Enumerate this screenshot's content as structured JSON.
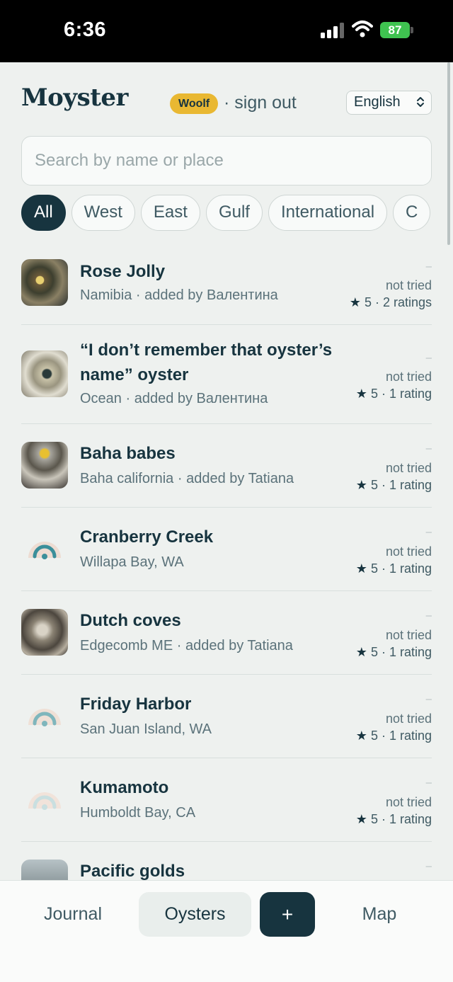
{
  "statusbar": {
    "time": "6:36",
    "battery": "87"
  },
  "header": {
    "logo": "Moyster",
    "user": "Woolf",
    "signout": "· sign out",
    "language": "English"
  },
  "search": {
    "placeholder": "Search by name or place"
  },
  "filters": [
    "All",
    "West",
    "East",
    "Gulf",
    "International",
    "C"
  ],
  "oysters": [
    {
      "name": "Rose Jolly",
      "sub": "Namibia · added by Валентина",
      "dash": "–",
      "status": "not tried",
      "rating": "5 · 2 ratings"
    },
    {
      "name": "“I don’t remember that oyster’s",
      "name2": "name” oyster",
      "sub": "Ocean · added by Валентина",
      "dash": "–",
      "status": "not tried",
      "rating": "5 · 1 rating"
    },
    {
      "name": "Baha babes",
      "sub": "Baha california · added by Tatiana",
      "dash": "–",
      "status": "not tried",
      "rating": "5 · 1 rating"
    },
    {
      "name": "Cranberry Creek",
      "sub": "Willapa Bay, WA",
      "dash": "–",
      "status": "not tried",
      "rating": "5 · 1 rating"
    },
    {
      "name": "Dutch coves",
      "sub": "Edgecomb ME · added by Tatiana",
      "dash": "–",
      "status": "not tried",
      "rating": "5 · 1 rating"
    },
    {
      "name": "Friday Harbor",
      "sub": "San Juan Island, WA",
      "dash": "–",
      "status": "not tried",
      "rating": "5 · 1 rating"
    },
    {
      "name": "Kumamoto",
      "sub": "Humboldt Bay, CA",
      "dash": "–",
      "status": "not tried",
      "rating": "5 · 1 rating"
    },
    {
      "name": "Pacific golds",
      "dash": "–"
    }
  ],
  "nav": {
    "journal": "Journal",
    "oysters": "Oysters",
    "add": "+",
    "map": "Map"
  },
  "colors": {
    "primary": "#17343f",
    "badge": "#e9b832",
    "background": "#eef1ef"
  }
}
